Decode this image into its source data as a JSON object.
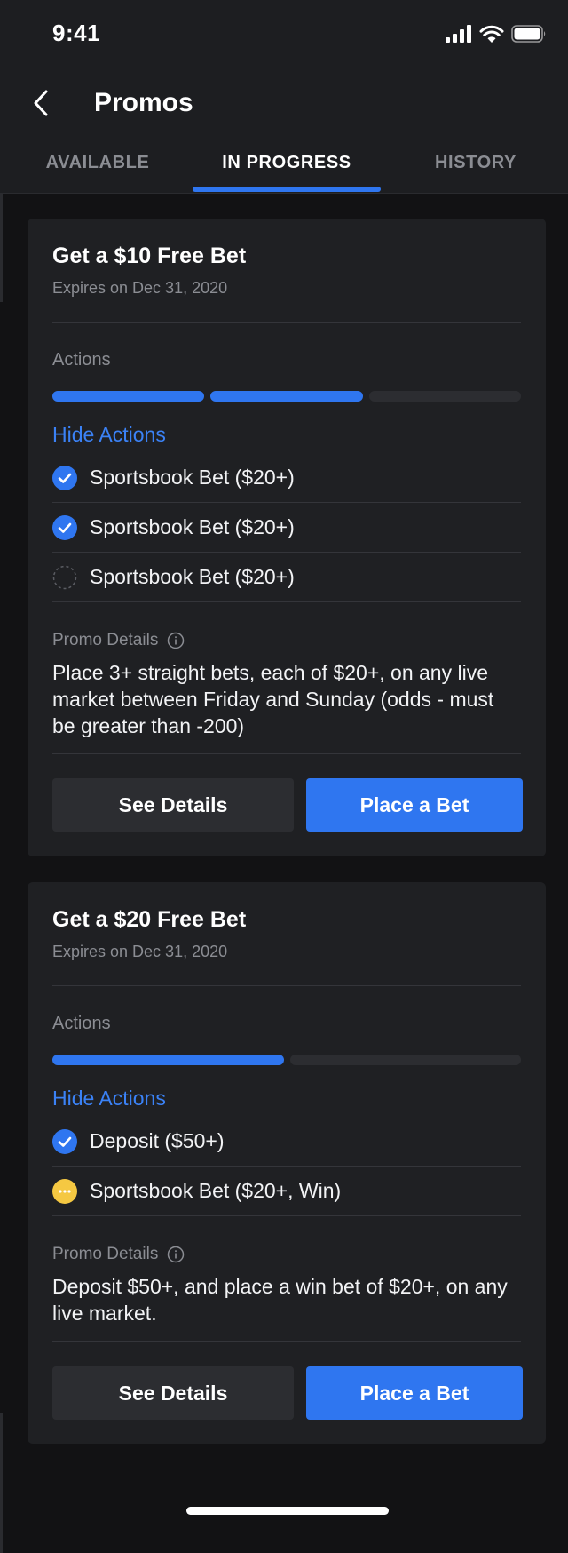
{
  "status_bar": {
    "time": "9:41"
  },
  "header": {
    "title": "Promos"
  },
  "tabs": [
    {
      "label": "AVAILABLE",
      "active": false
    },
    {
      "label": "IN PROGRESS",
      "active": true
    },
    {
      "label": "HISTORY",
      "active": false
    }
  ],
  "promos": [
    {
      "title": "Get a $10 Free Bet",
      "expiry": "Expires on Dec 31, 2020",
      "actions_label": "Actions",
      "progress": {
        "completed": 2,
        "total": 3
      },
      "hide_actions_label": "Hide Actions",
      "actions": [
        {
          "label": "Sportsbook Bet ($20+)",
          "status": "complete"
        },
        {
          "label": "Sportsbook Bet ($20+)",
          "status": "complete"
        },
        {
          "label": "Sportsbook Bet ($20+)",
          "status": "not-started"
        }
      ],
      "details_label": "Promo Details",
      "details": "Place 3+ straight bets, each of $20+, on any live market between Friday and Sunday (odds - must be greater than -200)",
      "secondary_button": "See Details",
      "primary_button": "Place a Bet"
    },
    {
      "title": "Get a $20 Free Bet",
      "expiry": "Expires on Dec 31, 2020",
      "actions_label": "Actions",
      "progress": {
        "completed": 1,
        "total": 2
      },
      "hide_actions_label": "Hide Actions",
      "actions": [
        {
          "label": "Deposit ($50+)",
          "status": "complete"
        },
        {
          "label": "Sportsbook Bet ($20+, Win)",
          "status": "pending"
        }
      ],
      "details_label": "Promo Details",
      "details": "Deposit $50+, and place a win bet of $20+, on any live market.",
      "secondary_button": "See Details",
      "primary_button": "Place a Bet"
    }
  ],
  "colors": {
    "accent": "#2f76f0",
    "link": "#3b82f6",
    "pending": "#f5c842",
    "background": "#121214",
    "card": "#1f2023"
  }
}
